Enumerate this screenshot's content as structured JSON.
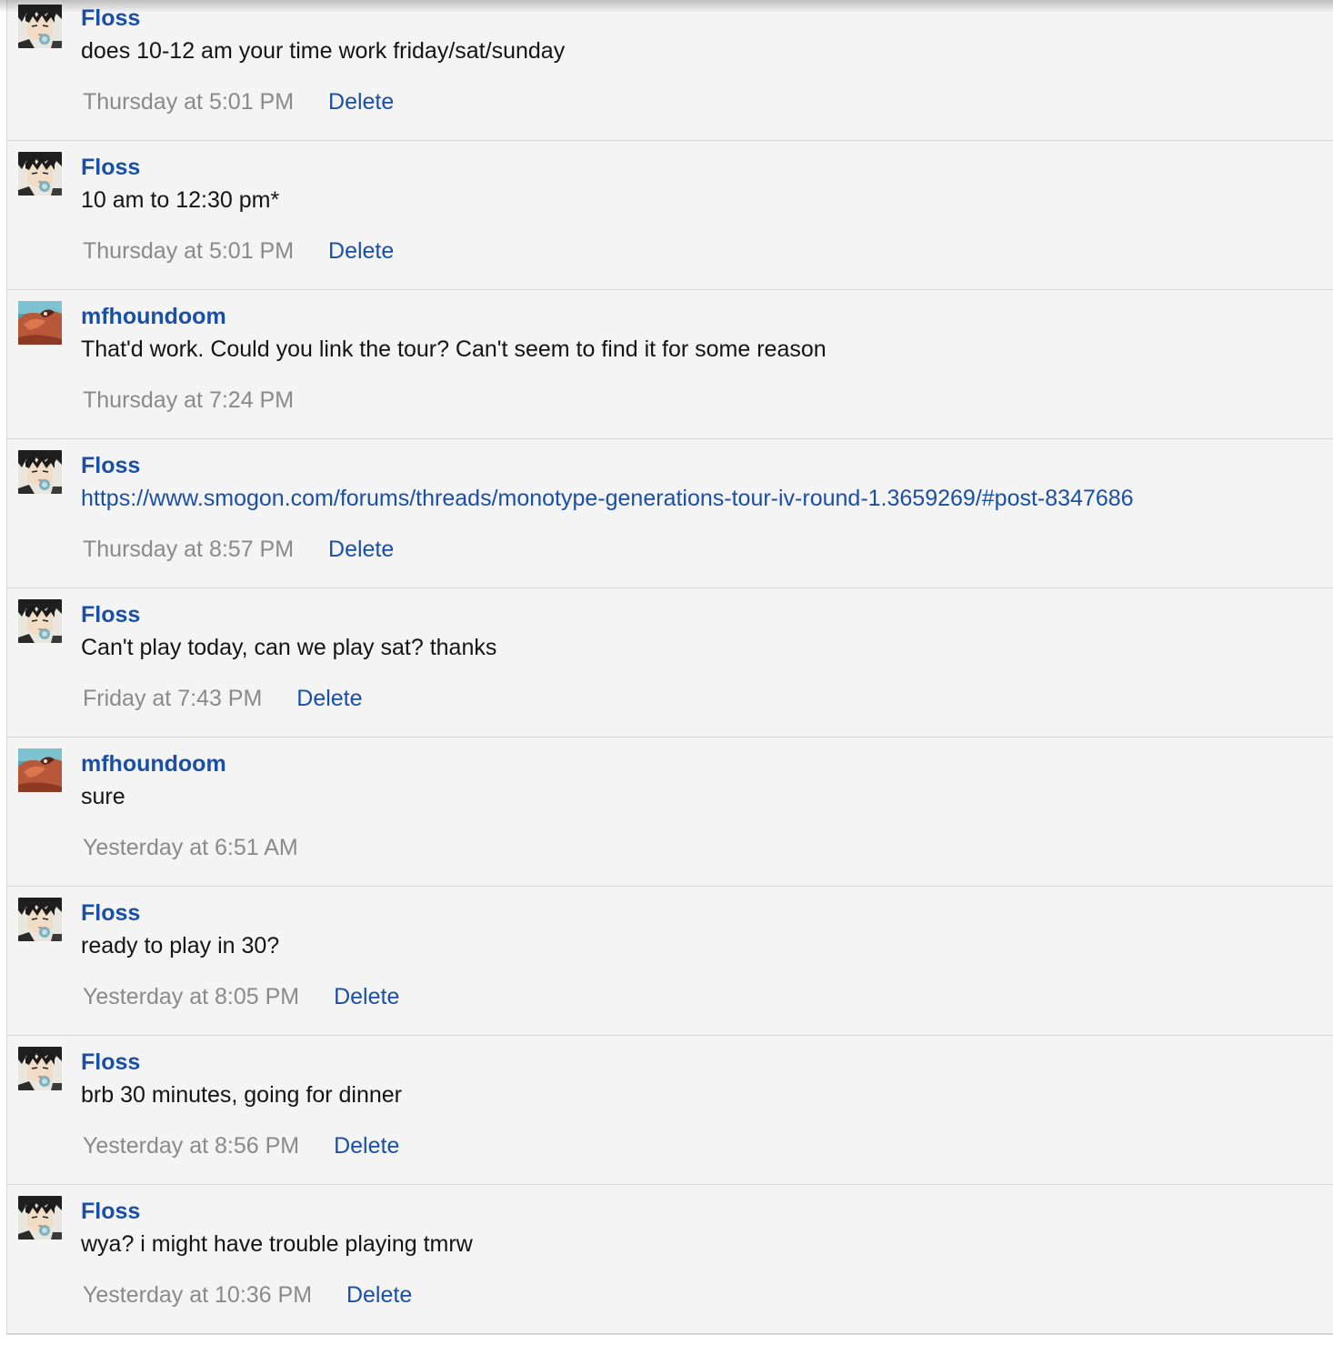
{
  "messages": [
    {
      "author": "Floss",
      "avatar": "floss-avatar",
      "text": "does 10-12 am your time work friday/sat/sunday",
      "time": "Thursday at 5:01 PM",
      "delete": "Delete"
    },
    {
      "author": "Floss",
      "avatar": "floss-avatar",
      "text": "10 am to 12:30 pm*",
      "time": "Thursday at 5:01 PM",
      "delete": "Delete"
    },
    {
      "author": "mfhoundoom",
      "avatar": "mfhoundoom-avatar",
      "text": "That'd work. Could you link the tour? Can't seem to find it for some reason",
      "time": "Thursday at 7:24 PM"
    },
    {
      "author": "Floss",
      "avatar": "floss-avatar",
      "text": "https://www.smogon.com/forums/threads/monotype-generations-tour-iv-round-1.3659269/#post-8347686",
      "is_link": true,
      "time": "Thursday at 8:57 PM",
      "delete": "Delete"
    },
    {
      "author": "Floss",
      "avatar": "floss-avatar",
      "text": "Can't play today, can we play sat? thanks",
      "time": "Friday at 7:43 PM",
      "delete": "Delete"
    },
    {
      "author": "mfhoundoom",
      "avatar": "mfhoundoom-avatar",
      "text": "sure",
      "time": "Yesterday at 6:51 AM"
    },
    {
      "author": "Floss",
      "avatar": "floss-avatar",
      "text": "ready to play in 30?",
      "time": "Yesterday at 8:05 PM",
      "delete": "Delete"
    },
    {
      "author": "Floss",
      "avatar": "floss-avatar",
      "text": "brb 30 minutes, going for dinner",
      "time": "Yesterday at 8:56 PM",
      "delete": "Delete"
    },
    {
      "author": "Floss",
      "avatar": "floss-avatar",
      "text": "wya? i might have trouble playing tmrw",
      "time": "Yesterday at 10:36 PM",
      "delete": "Delete"
    }
  ],
  "colors": {
    "link": "#1a4fa6",
    "text": "#141414",
    "timestamp": "#8a8a8a",
    "row_background": "#f4f4f4"
  }
}
